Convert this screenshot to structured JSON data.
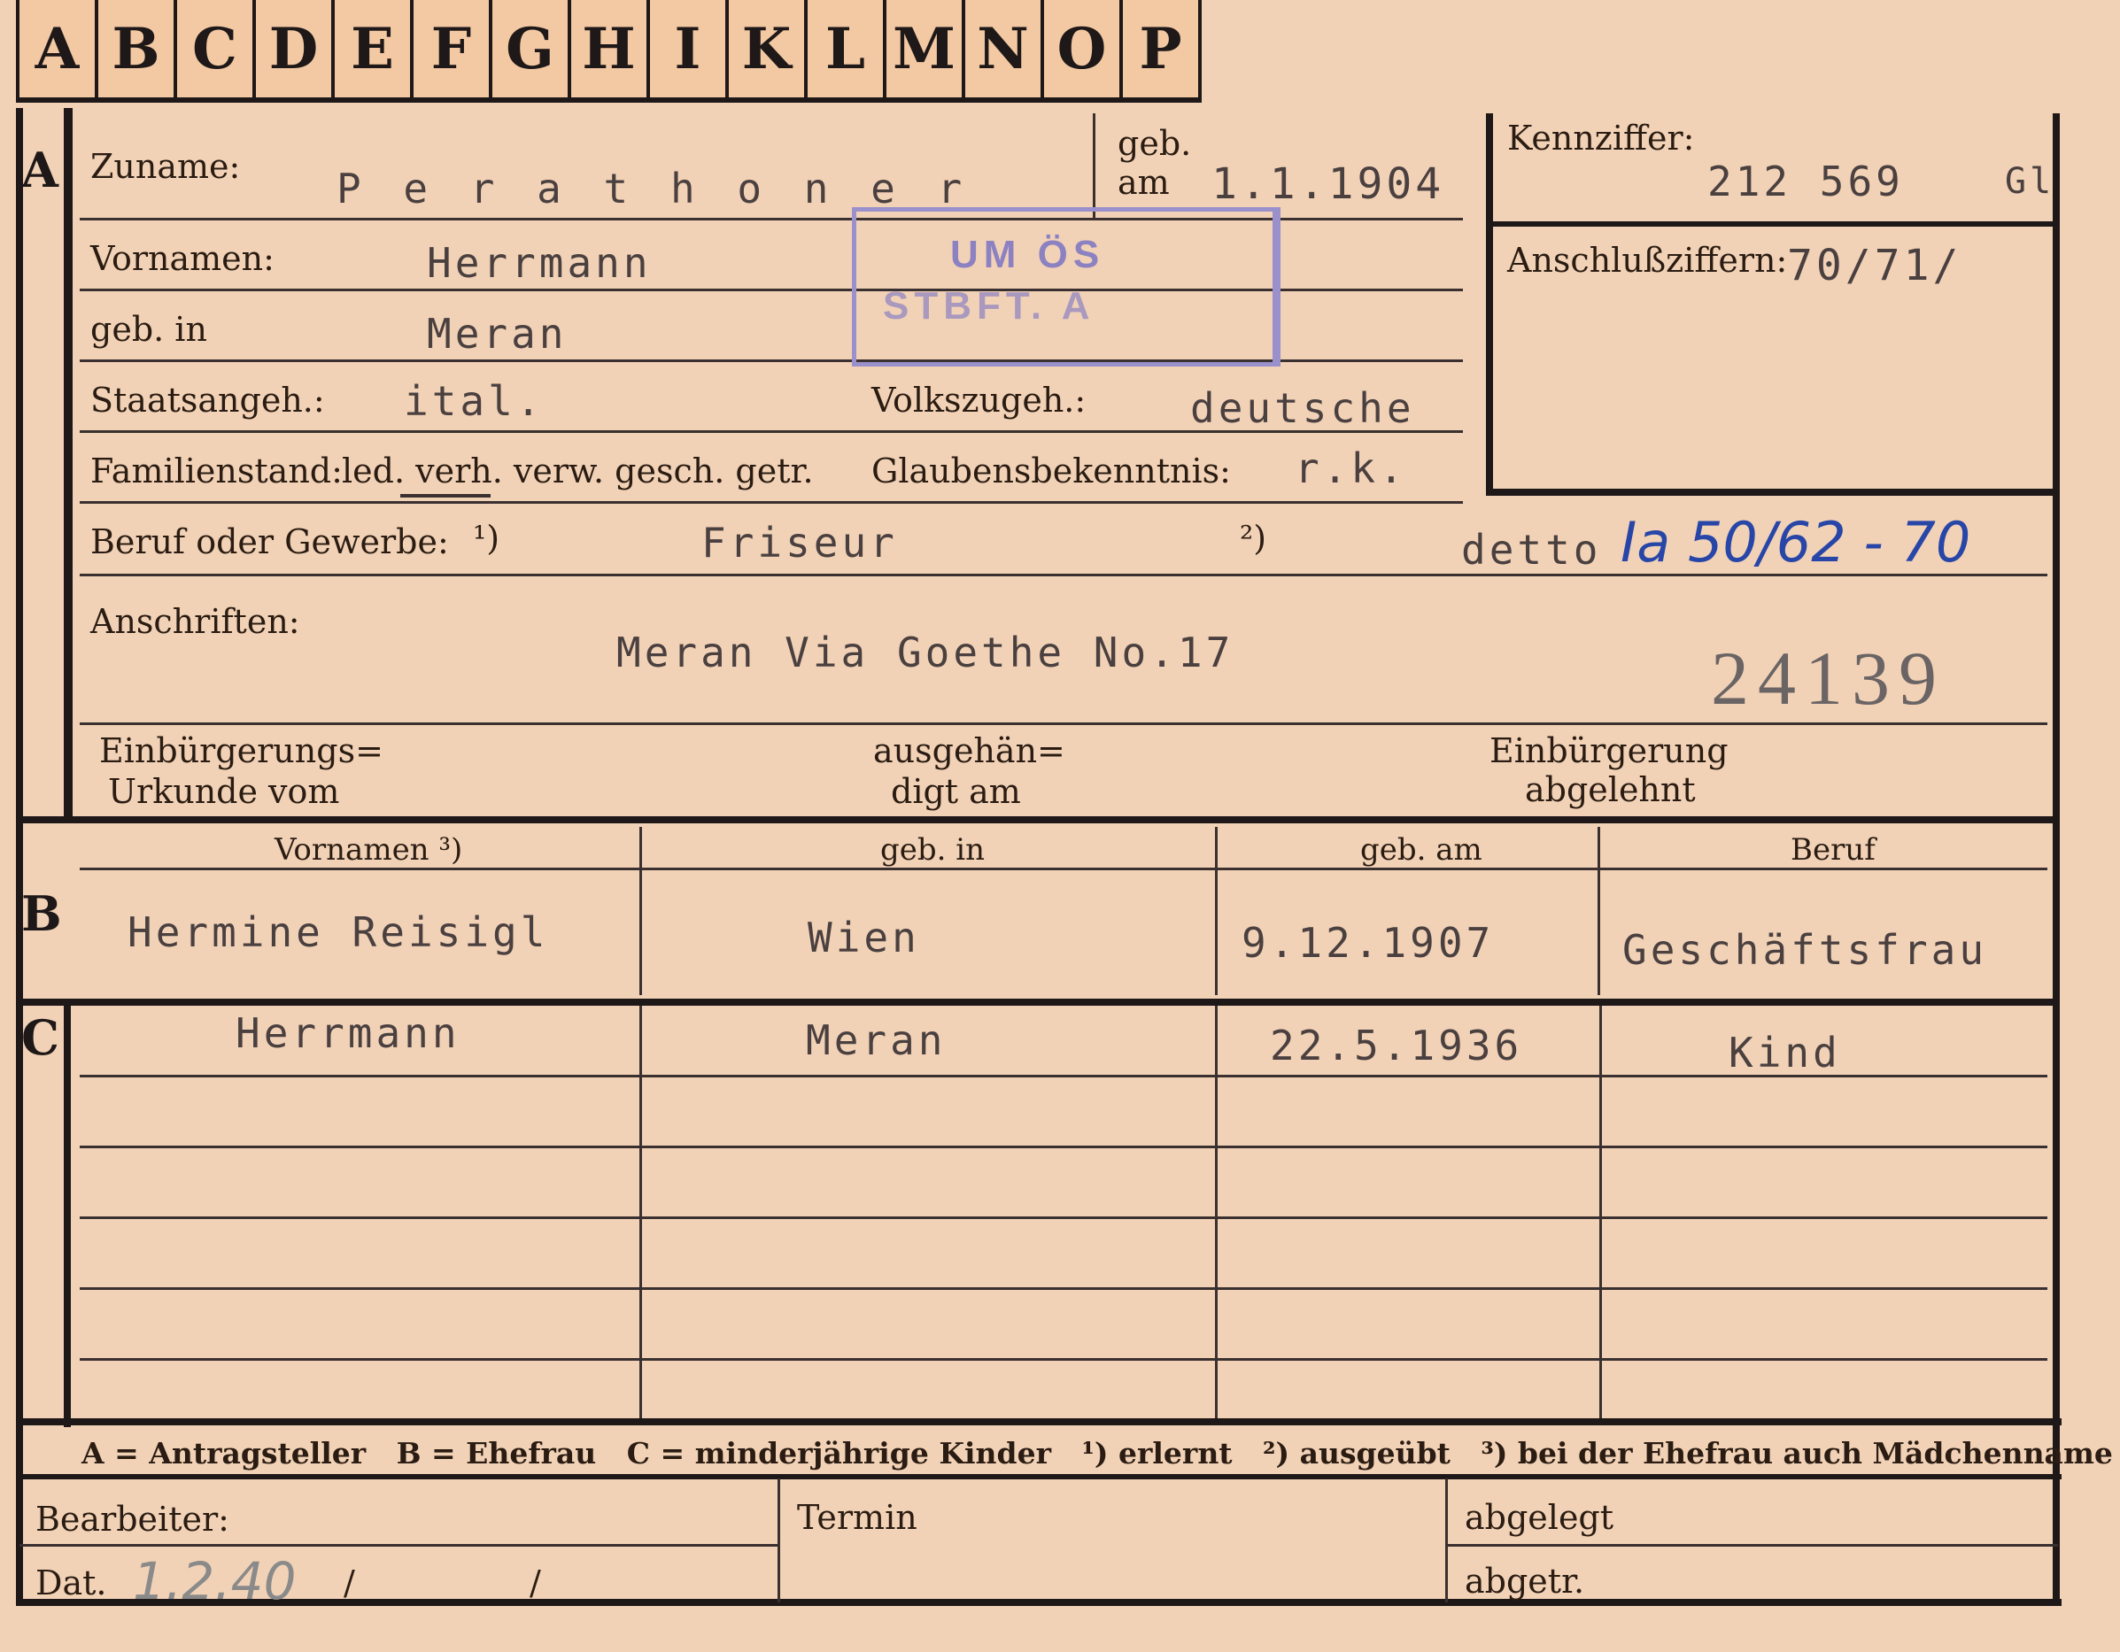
{
  "tabs": [
    "A",
    "B",
    "C",
    "D",
    "E",
    "F",
    "G",
    "H",
    "I",
    "K",
    "L",
    "M",
    "N",
    "O",
    "P"
  ],
  "sections": {
    "a": "A",
    "b": "B",
    "c": "C"
  },
  "applicant": {
    "surname_label": "Zuname:",
    "surname": "P e r a t h o n e r",
    "born_label_1": "geb.",
    "born_label_2": "am",
    "born_date": "1.1.1904",
    "first_names_label": "Vornamen:",
    "first_names": "Herrmann",
    "birthplace_label": "geb. in",
    "birthplace": "Meran",
    "citizenship_label": "Staatsangeh.:",
    "citizenship": "ital.",
    "ethnicity_label": "Volkszugeh.:",
    "ethnicity": "deutsche",
    "family_status_label": "Familienstand:",
    "family_status_options": "led. verh. verw. gesch. getr.",
    "religion_label": "Glaubensbekenntnis:",
    "religion": "r.k.",
    "occupation_label": "Beruf oder Gewerbe:",
    "occupation_note1": "¹)",
    "occupation": "Friseur",
    "occupation_note2": "²)",
    "occupation_practiced": "detto",
    "file_ref": "Ia 50/62 - 70",
    "address_label": "Anschriften:",
    "address": "Meran Via Goethe No.17",
    "stamped_number": "24139",
    "naturalization_doc_label_1": "Einbürgerungs=",
    "naturalization_doc_label_2": "Urkunde vom",
    "handed_out_label_1": "ausgehän=",
    "handed_out_label_2": "digt am",
    "refused_label_1": "Einbürgerung",
    "refused_label_2": "abgelehnt"
  },
  "stamp": {
    "line1": "UM ÖS",
    "line2": "STBFT. A"
  },
  "id_box": {
    "code_label": "Kennziffer:",
    "code": "212 569",
    "code_suffix": "Gl",
    "connection_label": "Anschlußziffern:",
    "connection": "70/71/"
  },
  "table_headers": [
    "Vornamen ³)",
    "geb. in",
    "geb. am",
    "Beruf"
  ],
  "spouse": {
    "first_names": "Hermine Reisigl",
    "birthplace": "Wien",
    "born": "9.12.1907",
    "occupation": "Geschäftsfrau"
  },
  "children": [
    {
      "first_names": "Herrmann",
      "birthplace": "Meran",
      "born": "22.5.1936",
      "occupation": "Kind"
    }
  ],
  "legend": "A = Antragsteller   B = Ehefrau   C = minderjährige Kinder   ¹) erlernt   ²) ausgeübt   ³) bei der Ehefrau auch Mädchenname",
  "footer": {
    "processor_label": "Bearbeiter:",
    "date_label": "Dat.",
    "date_value": "1.2.40",
    "slash1": "/",
    "slash2": "/",
    "deadline_label": "Termin",
    "filed_label": "abgelegt",
    "sent_label": "abgetr."
  }
}
